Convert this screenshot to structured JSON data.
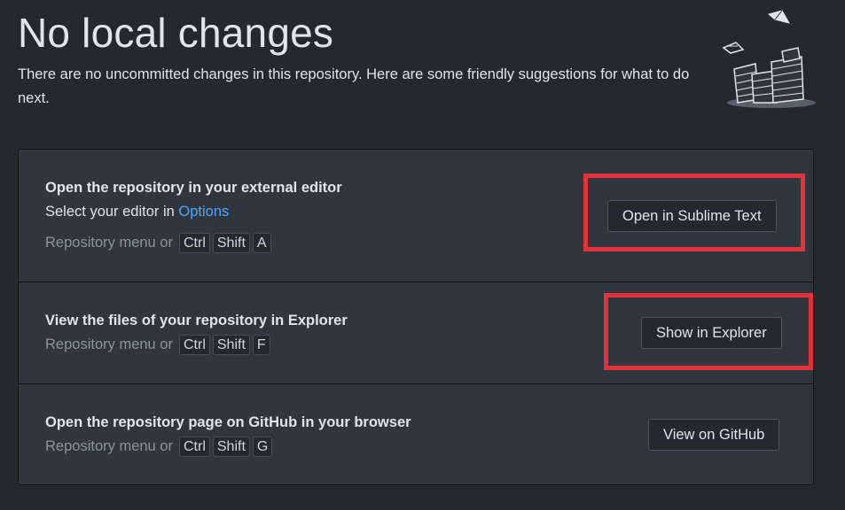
{
  "header": {
    "title": "No local changes",
    "subtitle": "There are no uncommitted changes in this repository. Here are some friendly suggestions for what to do next."
  },
  "suggestions": [
    {
      "title": "Open the repository in your external editor",
      "desc_prefix": "Select your editor in ",
      "desc_link": "Options",
      "shortcut_label": "Repository menu or",
      "keys": [
        "Ctrl",
        "Shift",
        "A"
      ],
      "button": "Open in Sublime Text"
    },
    {
      "title": "View the files of your repository in Explorer",
      "shortcut_label": "Repository menu or",
      "keys": [
        "Ctrl",
        "Shift",
        "F"
      ],
      "button": "Show in Explorer"
    },
    {
      "title": "Open the repository page on GitHub in your browser",
      "shortcut_label": "Repository menu or",
      "keys": [
        "Ctrl",
        "Shift",
        "G"
      ],
      "button": "View on GitHub"
    }
  ],
  "colors": {
    "background": "#24292e",
    "panel": "#2f363d",
    "link": "#4ca6ff",
    "highlight": "#e5323a"
  },
  "icons": {
    "illustration": "paper-stack-illustration-icon"
  }
}
